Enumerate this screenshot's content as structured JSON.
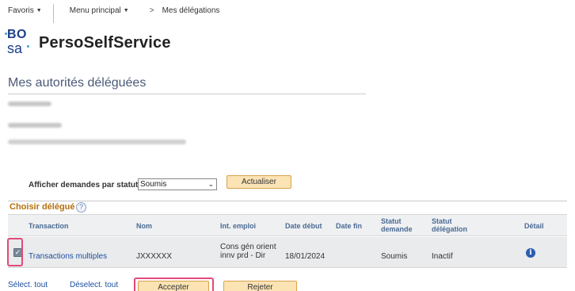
{
  "topnav": {
    "favorites": "Favoris",
    "main_menu": "Menu principal",
    "breadcrumb_separator": ">",
    "breadcrumb_current": "Mes délégations"
  },
  "brand": {
    "logo_line1": "BO",
    "logo_line2": "sa",
    "app_name": "PersoSelfService",
    "logo_color": "#1c3d8c",
    "dot_color": "#3aa0d8"
  },
  "page": {
    "title": "Mes autorités déléguées"
  },
  "filter": {
    "label": "Afficher demandes par statut",
    "selected_status": "Soumis",
    "refresh_button": "Actualiser"
  },
  "table": {
    "caption": "Choisir délégué",
    "help_glyph": "?",
    "columns": [
      "Transaction",
      "Nom",
      "Int. emploi",
      "Date début",
      "Date fin",
      "Statut demande",
      "Statut délégation",
      "Détail"
    ],
    "rows": [
      {
        "selected": true,
        "transaction": "Transactions multiples",
        "nom": "JXXXXXX",
        "int_emploi": "Cons gén orient innv prd - Dir",
        "date_debut": "18/01/2024",
        "date_fin": "",
        "statut_demande": "Soumis",
        "statut_delegation": "Inactif",
        "detail_glyph": "i"
      }
    ]
  },
  "actions": {
    "select_all": "Sélect. tout",
    "deselect_all": "Déselect. tout",
    "accept": "Accepter",
    "reject": "Rejeter"
  },
  "colors": {
    "accent_button": "#fbe3b4",
    "caption_orange": "#b5700d",
    "link_blue": "#1d4fa0",
    "highlight": "#e04b78"
  }
}
